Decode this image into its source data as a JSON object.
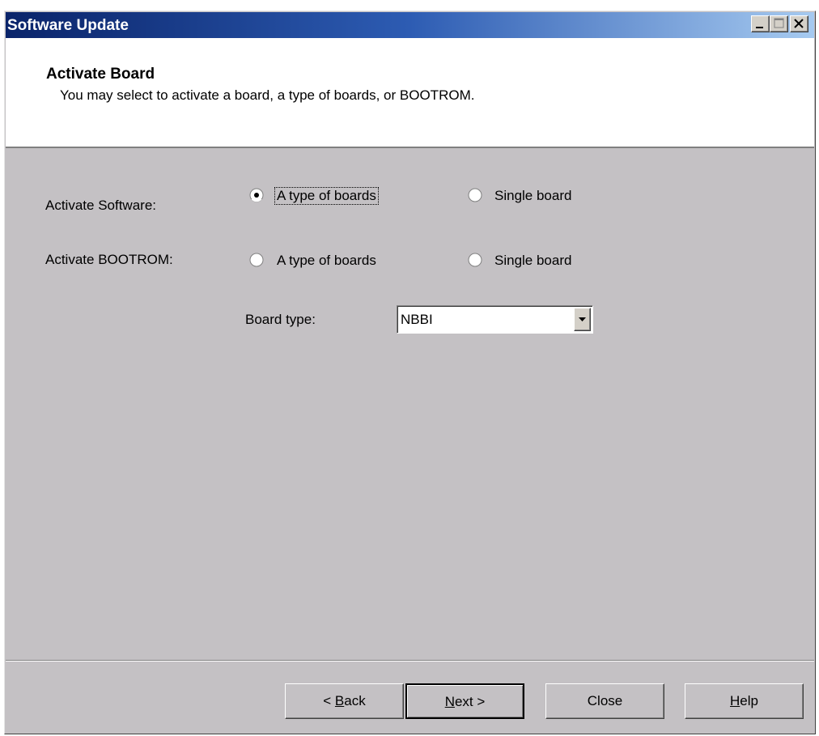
{
  "window": {
    "title": "Software Update"
  },
  "header": {
    "title": "Activate Board",
    "subtitle": "You may select to activate a board, a type of boards, or BOOTROM."
  },
  "activate_software": {
    "label": "Activate Software:",
    "option_type": "A type of boards",
    "option_single": "Single board",
    "selected": "A type of boards"
  },
  "activate_bootrom": {
    "label": "Activate BOOTROM:",
    "option_type": "A type of boards",
    "option_single": "Single board"
  },
  "board_type": {
    "label": "Board type:",
    "value": "NBBI"
  },
  "buttons": {
    "back": {
      "pre": "< ",
      "mnemonic": "B",
      "post": "ack"
    },
    "next": {
      "pre": "",
      "mnemonic": "N",
      "post": "ext >"
    },
    "close": "Close",
    "help": {
      "pre": "",
      "mnemonic": "H",
      "post": "elp"
    }
  }
}
